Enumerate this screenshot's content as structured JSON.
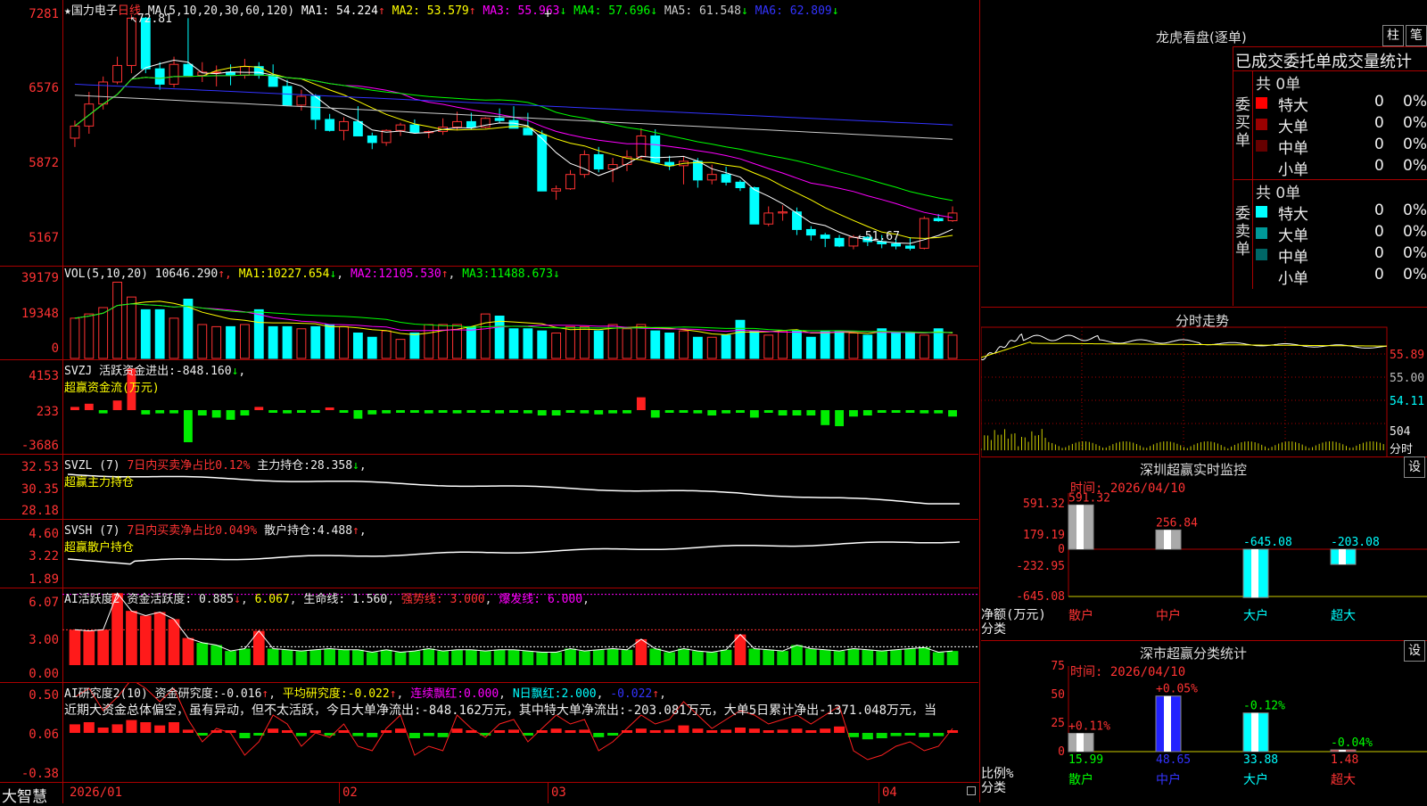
{
  "stock": {
    "star": "★",
    "name": "国力电子",
    "period": "日线"
  },
  "kline": {
    "ma_header": "MA(5,10,20,30,60,120)",
    "ma": [
      {
        "label": "MA1:",
        "value": "54.224",
        "arrow": "↑",
        "color": "#ffffff"
      },
      {
        "label": "MA2:",
        "value": "53.579",
        "arrow": "↑",
        "color": "#ffff00"
      },
      {
        "label": "MA3:",
        "value": "55.963",
        "arrow": "↓",
        "color": "#ff00ff"
      },
      {
        "label": "MA4:",
        "value": "57.696",
        "arrow": "↓",
        "color": "#00ff00"
      },
      {
        "label": "MA5:",
        "value": "61.548",
        "arrow": "↓",
        "color": "#cccccc"
      },
      {
        "label": "MA6:",
        "value": "62.809",
        "arrow": "↓",
        "color": "#3333ff"
      }
    ],
    "y_labels": [
      "7281",
      "6576",
      "5872",
      "5167"
    ],
    "high_label": "72.81",
    "low_label": "51.67",
    "candles": [
      [
        61.6,
        63.2,
        60.8,
        62.7
      ],
      [
        62.7,
        65.8,
        62,
        64.7
      ],
      [
        64.7,
        67.2,
        64.2,
        66.7
      ],
      [
        66.7,
        69,
        66.5,
        68.2
      ],
      [
        68.2,
        72.8,
        67.5,
        72.5
      ],
      [
        72.5,
        72.6,
        67.5,
        67.9
      ],
      [
        67.9,
        68.5,
        66,
        66.5
      ],
      [
        66.5,
        69,
        66.2,
        68.3
      ],
      [
        68.3,
        72.5,
        67.6,
        67.3
      ],
      [
        67.3,
        68.5,
        66.7,
        67.6
      ],
      [
        67.6,
        68.2,
        66.3,
        67.6
      ],
      [
        67.6,
        68.3,
        66.4,
        67.3
      ],
      [
        67.3,
        68.8,
        67,
        68.1
      ],
      [
        68.1,
        68.5,
        67,
        67.3
      ],
      [
        67.3,
        68.3,
        66.5,
        66.3
      ],
      [
        66.3,
        66.9,
        64.5,
        64.6
      ],
      [
        64.6,
        66,
        64.1,
        65.4
      ],
      [
        65.4,
        65.6,
        62.4,
        63.3
      ],
      [
        63.3,
        63.8,
        62.2,
        62.3
      ],
      [
        62.3,
        63.5,
        61.4,
        63.1
      ],
      [
        63.1,
        64.5,
        62.4,
        61.8
      ],
      [
        61.8,
        62.1,
        60.6,
        61.2
      ],
      [
        61.2,
        62.4,
        60.9,
        62.3
      ],
      [
        62.3,
        63,
        61.8,
        62.8
      ],
      [
        62.8,
        63.3,
        62.4,
        62.1
      ],
      [
        62.1,
        62.3,
        61.6,
        62.2
      ],
      [
        62.2,
        63.4,
        61.9,
        62.6
      ],
      [
        62.6,
        64,
        62.3,
        63.1
      ],
      [
        63.1,
        63.9,
        62.4,
        62.6
      ],
      [
        62.6,
        63.5,
        62.5,
        63.4
      ],
      [
        63.4,
        64.3,
        63,
        63.2
      ],
      [
        63.2,
        64.5,
        62.5,
        62.5
      ],
      [
        62.5,
        63.9,
        62,
        61.9
      ],
      [
        61.9,
        62.3,
        56.8,
        56.8
      ],
      [
        56.8,
        57.3,
        56,
        57
      ],
      [
        57,
        58.7,
        56.9,
        58.3
      ],
      [
        58.3,
        60.5,
        58,
        60.1
      ],
      [
        60.1,
        60.8,
        58.5,
        58.8
      ],
      [
        58.8,
        59.8,
        57.6,
        59.2
      ],
      [
        59.2,
        60.5,
        58.6,
        59.9
      ],
      [
        59.9,
        62.5,
        59.6,
        61.8
      ],
      [
        61.8,
        62.4,
        59.5,
        59.4
      ],
      [
        59.4,
        60,
        58.7,
        59.1
      ],
      [
        59.1,
        59.9,
        57.4,
        59.5
      ],
      [
        59.5,
        59.8,
        57.1,
        57.8
      ],
      [
        57.8,
        59.2,
        57.4,
        58.3
      ],
      [
        58.3,
        59,
        57.3,
        57.6
      ],
      [
        57.6,
        57.8,
        56.8,
        57.1
      ],
      [
        57.1,
        57.2,
        53.8,
        53.8
      ],
      [
        53.8,
        55.4,
        53.6,
        54.8
      ],
      [
        54.8,
        55.5,
        54.1,
        54.9
      ],
      [
        54.9,
        55.3,
        52.8,
        53.3
      ],
      [
        53.3,
        53.6,
        52.3,
        52.8
      ],
      [
        52.8,
        53,
        51.7,
        52.5
      ],
      [
        52.5,
        52.8,
        51.7,
        51.8
      ],
      [
        51.8,
        52.8,
        51.5,
        52.6
      ],
      [
        52.6,
        52.7,
        51.8,
        52.2
      ],
      [
        52.2,
        52.8,
        51.6,
        52
      ],
      [
        52,
        52.5,
        51.5,
        51.8
      ],
      [
        51.8,
        52.6,
        51.4,
        51.6
      ],
      [
        51.6,
        54.5,
        51.5,
        54.3
      ],
      [
        54.3,
        54.7,
        54,
        54.1
      ],
      [
        54.1,
        55.4,
        54,
        54.8
      ]
    ]
  },
  "vol": {
    "header": "VOL(5,10,20)",
    "value": "10646.290",
    "ma": [
      {
        "label": "MA1:",
        "value": "10227.654",
        "arrow": "↓"
      },
      {
        "label": "MA2:",
        "value": "12105.530",
        "arrow": "↑"
      },
      {
        "label": "MA3:",
        "value": "11488.673",
        "arrow": "↓"
      }
    ],
    "y_labels": [
      "39179",
      "19348",
      "0"
    ],
    "bars": [
      19,
      21,
      24,
      36,
      29,
      23,
      23,
      19,
      28,
      16,
      15,
      15,
      16,
      23,
      15,
      15,
      14,
      15,
      16,
      15,
      12,
      10,
      13,
      9,
      12,
      16,
      16,
      16,
      15,
      21,
      20,
      14,
      14,
      13,
      12,
      15,
      15,
      13,
      16,
      14,
      16,
      13,
      12,
      13,
      10,
      10,
      11,
      18,
      13,
      11,
      13,
      13,
      10,
      13,
      13,
      12,
      11,
      14,
      12,
      12,
      11,
      14,
      11
    ]
  },
  "svzj": {
    "name": "SVZJ",
    "label": "活跃资金进出:",
    "value": "-848.160",
    "arrow": "↓",
    "comma": ",",
    "subtitle": "超赢资金流(万元)",
    "y_labels": [
      "4153",
      "233",
      "-3686"
    ],
    "bars": [
      300,
      600,
      -300,
      900,
      3900,
      -400,
      -300,
      -300,
      -3000,
      -500,
      -700,
      -900,
      -500,
      300,
      -200,
      -300,
      -200,
      -200,
      100,
      -200,
      -800,
      -400,
      -300,
      -200,
      -200,
      -300,
      -200,
      -300,
      -200,
      -200,
      -300,
      -200,
      -300,
      -500,
      -500,
      -200,
      -300,
      -400,
      -300,
      -300,
      1200,
      -700,
      -200,
      -200,
      -300,
      -500,
      -300,
      -200,
      -700,
      -200,
      -500,
      -500,
      -500,
      -1400,
      -1500,
      -600,
      -500,
      -200,
      -200,
      -200,
      -300,
      -300,
      -600
    ]
  },
  "svzl": {
    "name": "SVZL (7)",
    "info": "7日内买卖净占比0.12%",
    "label": "主力持仓:",
    "value": "28.358",
    "arrow": "↓",
    "comma": ",",
    "subtitle": "超赢主力持仓",
    "y_labels": [
      "32.53",
      "30.35",
      "28.18"
    ]
  },
  "svsh": {
    "name": "SVSH (7)",
    "info": "7日内买卖净占比0.049%",
    "label": "散户持仓:",
    "value": "4.488",
    "arrow": "↑",
    "comma": ",",
    "subtitle": "超赢散户持仓",
    "y_labels": [
      "4.60",
      "3.22",
      "1.89"
    ]
  },
  "ai_active": {
    "name": "AI活跃度2",
    "label": "资金活跃度:",
    "value": "0.885",
    "arrow": "↓",
    "v2": "6.067",
    "label2": "生命线:",
    "v3": "1.560",
    "strong": "强势线:",
    "strong_v": "3.000",
    "burst": "爆发线:",
    "burst_v": "6.000",
    "y_labels": [
      "6.07",
      "3.00",
      "0.00"
    ],
    "bars": [
      3,
      2.9,
      3,
      6.1,
      4.6,
      4.2,
      4.5,
      3.9,
      2.3,
      1.9,
      1.7,
      1.2,
      1.4,
      2.9,
      1.4,
      1.3,
      1.2,
      1.3,
      1.4,
      1.3,
      1.3,
      1.1,
      1.3,
      1.1,
      1.2,
      1.4,
      1.2,
      1.3,
      1.3,
      1.2,
      1.3,
      1.3,
      1.2,
      1.1,
      1.1,
      1.4,
      1.2,
      1.3,
      1.4,
      1.3,
      2.2,
      1.4,
      1.1,
      1.4,
      1.2,
      1.1,
      1.3,
      2.6,
      1.4,
      1.3,
      1.2,
      1.7,
      1.4,
      1.3,
      1.2,
      1.4,
      1.3,
      1.2,
      1.3,
      1.4,
      1.5,
      1.1,
      1.2
    ]
  },
  "ai_research": {
    "name": "AI研究度2(10)",
    "label": "资金研究度:",
    "value": "-0.016",
    "arrow": "↑",
    "avg": "平均研究度:",
    "avg_v": "-0.022",
    "a2": "↑",
    "streak": "连续飘红:",
    "streak_v": "0.000",
    "nday": "N日飘红:",
    "nday_v": "2.000",
    "last": "-0.022",
    "a3": "↑",
    "y_labels": [
      "0.50",
      "0.06",
      "-0.38"
    ],
    "text": "近期大资金总体偏空，虽有异动，但不太活跃，今日大单净流出:-848.162万元，其中特大单净流出:-203.081万元，大单5日累计净出-1371.048万元，当",
    "bars": [
      0.08,
      0.1,
      0.05,
      0.08,
      0.12,
      0.1,
      0.07,
      0.1,
      0.03,
      -0.02,
      0.01,
      0,
      -0.05,
      -0.02,
      0.04,
      0.02,
      -0.03,
      0,
      -0.01,
      0.02,
      -0.03,
      -0.04,
      0.01,
      0.04,
      -0.05,
      -0.03,
      -0.04,
      0.04,
      0.01,
      -0.01,
      0.02,
      0.03,
      -0.02,
      0.01,
      0.04,
      0.02,
      0.03,
      -0.04,
      -0.02,
      0.01,
      0.04,
      0.02,
      0.03,
      0.07,
      0.04,
      0.01,
      0.03,
      0.05,
      0.04,
      0.02,
      0.03,
      0.04,
      0.02,
      0.04,
      0.06,
      -0.04,
      -0.06,
      -0.05,
      -0.03,
      -0.02,
      -0.04,
      -0.03,
      0.01
    ]
  },
  "dates": {
    "brand": "大智慧",
    "labels": [
      "2026/01",
      "02",
      "03",
      "04"
    ]
  },
  "dragon": {
    "title": "龙虎看盘(逐单)",
    "btn1": "柱",
    "btn2": "笔",
    "heading": "已成交委托单成交量统计",
    "buy": {
      "side": "委买单",
      "total": "共 0单",
      "rows": [
        {
          "name": "特大",
          "n": "0",
          "p": "0%",
          "color": "#ff0000"
        },
        {
          "name": "大单",
          "n": "0",
          "p": "0%",
          "color": "#990000"
        },
        {
          "name": "中单",
          "n": "0",
          "p": "0%",
          "color": "#660000"
        },
        {
          "name": "小单",
          "n": "0",
          "p": "0%",
          "color": "#000000"
        }
      ]
    },
    "sell": {
      "side": "委卖单",
      "total": "共 0单",
      "rows": [
        {
          "name": "特大",
          "n": "0",
          "p": "0%",
          "color": "#00ffff"
        },
        {
          "name": "大单",
          "n": "0",
          "p": "0%",
          "color": "#009999"
        },
        {
          "name": "中单",
          "n": "0",
          "p": "0%",
          "color": "#006666"
        },
        {
          "name": "小单",
          "n": "0",
          "p": "0%",
          "color": "#000000"
        }
      ]
    }
  },
  "intraday": {
    "title": "分时走势",
    "y_labels": [
      "55.89",
      "55.00",
      "54.11"
    ],
    "vol_label": "504",
    "vol_unit": "分时"
  },
  "szmonitor": {
    "title": "深圳超赢实时监控",
    "btn": "设",
    "time": "时间: 2026/04/10",
    "unit": "净额(万元)",
    "cat": "分类",
    "y_labels": [
      "591.32",
      "179.19",
      "0",
      "-232.95",
      "-645.08"
    ],
    "cats": [
      "散户",
      "中户",
      "大户",
      "超大"
    ],
    "values": [
      591.32,
      256.84,
      -645.08,
      -203.08
    ],
    "value_labels": [
      "591.32",
      "256.84",
      "-645.08",
      "-203.08"
    ]
  },
  "szclass": {
    "title": "深市超赢分类统计",
    "btn": "设",
    "time": "时间: 2026/04/10",
    "unit": "比例%",
    "cat": "分类",
    "y_labels": [
      "75",
      "50",
      "25",
      "0"
    ],
    "cats": [
      "散户",
      "中户",
      "大户",
      "超大"
    ],
    "values": [
      15.99,
      48.65,
      33.88,
      1.48
    ],
    "pct": [
      "+0.11%",
      "+0.05%",
      "-0.12%",
      "-0.04%"
    ],
    "value_labels": [
      "15.99",
      "48.65",
      "33.88",
      "1.48"
    ]
  }
}
